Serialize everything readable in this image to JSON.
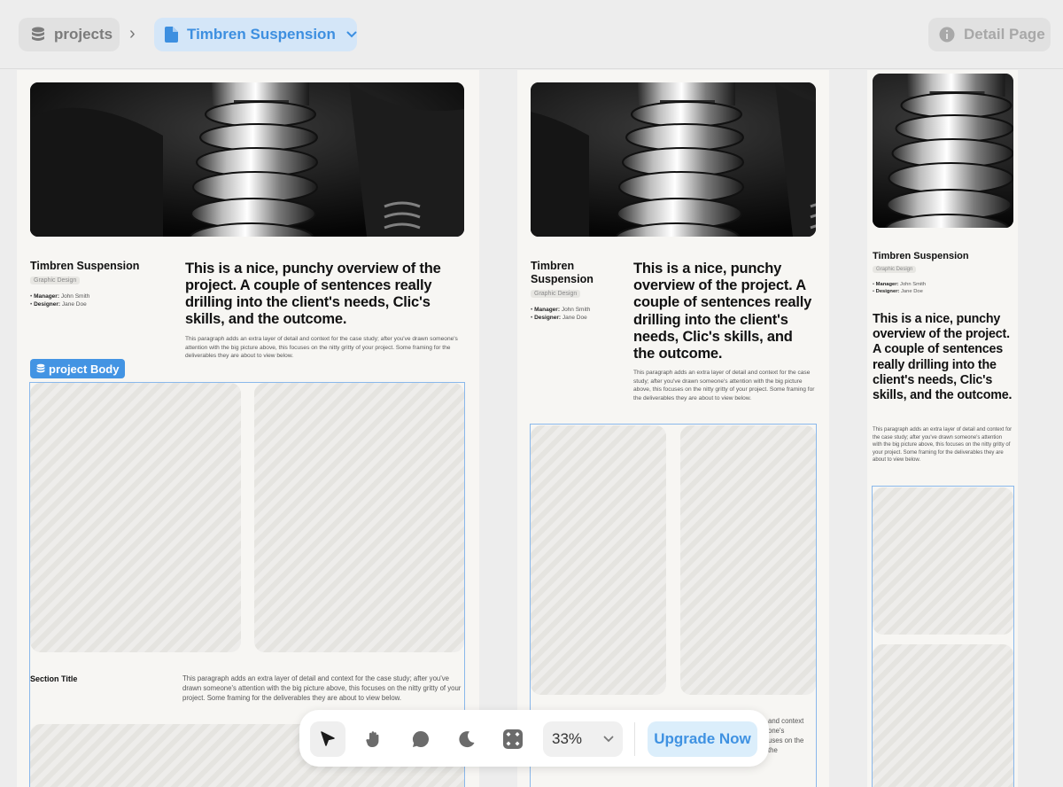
{
  "breadcrumb": {
    "projects_label": "projects",
    "separator": "›",
    "current_label": "Timbren Suspension"
  },
  "detail_button": {
    "label": "Detail Page"
  },
  "project": {
    "title": "Timbren Suspension",
    "title_line1": "Timbren",
    "title_line2": "Suspension",
    "category": "Graphic Design",
    "manager_label": "Manager:",
    "manager": "John Smith",
    "designer_label": "Designer:",
    "designer": "Jane Doe",
    "headline": "This is a nice, punchy overview of the project. A couple of sentences really drilling into the client's needs, Clic's skills, and the outcome.",
    "paragraph": "This paragraph adds an extra layer of detail and context for the case study; after you've drawn someone's attention with the big picture above, this focuses on the nitty gritty of your project. Some framing for the deliverables they are about to view below.",
    "body_label": "project Body",
    "section_title": "Section Title"
  },
  "frame2_peek": {
    "line1": "and context",
    "line2": "one's",
    "line3": "uses on the",
    "line4": "the"
  },
  "toolbar": {
    "tools": [
      "pointer-tool",
      "hand-tool",
      "comment-tool",
      "dark-mode-tool",
      "components-tool"
    ],
    "zoom": "33%",
    "upgrade_label": "Upgrade Now"
  },
  "colors": {
    "accent": "#4394e3",
    "accent_light": "#d4e6f8",
    "frame_bg": "#f7f6f3",
    "canvas_bg": "#ededed"
  }
}
